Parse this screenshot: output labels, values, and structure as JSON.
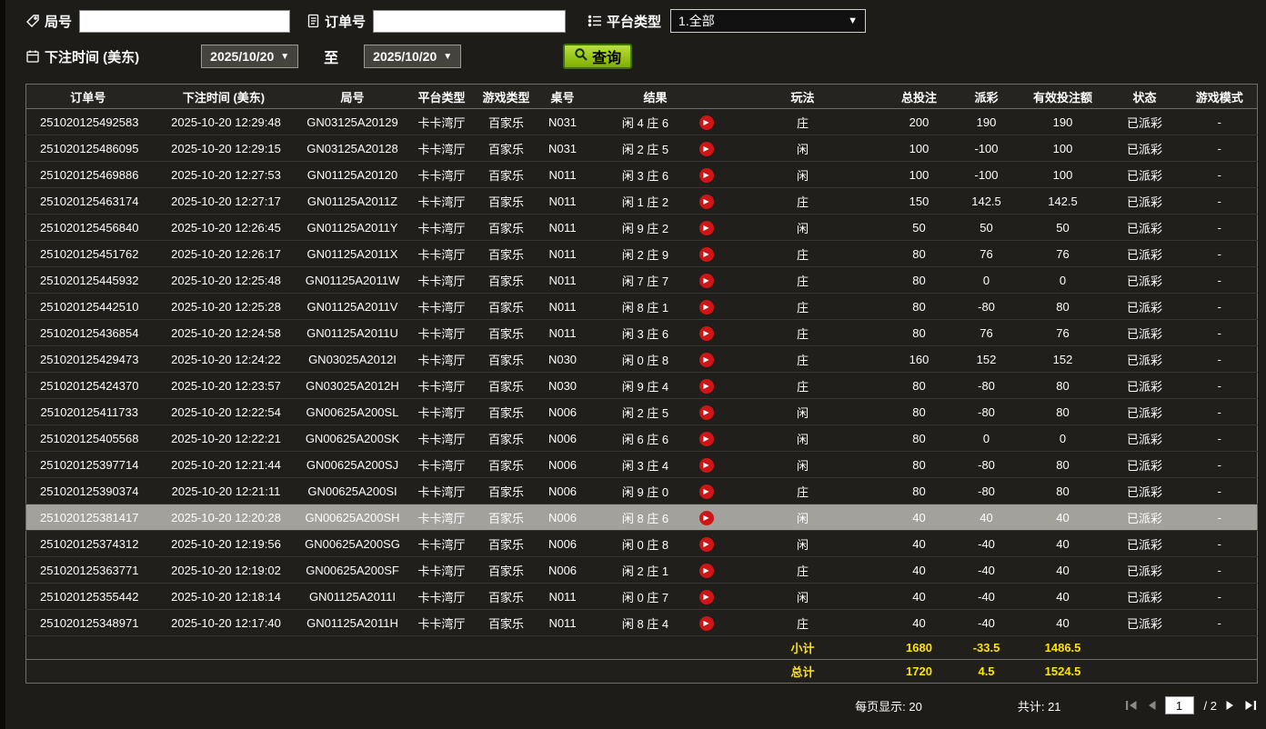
{
  "filters": {
    "round_label": "局号",
    "order_label": "订单号",
    "platform_label": "平台类型",
    "platform_value": "1.全部",
    "bet_time_label": "下注时间 (美东)",
    "date_from": "2025/10/20",
    "to_label": "至",
    "date_to": "2025/10/20",
    "query_label": "查询"
  },
  "table": {
    "headers": [
      "订单号",
      "下注时间 (美东)",
      "局号",
      "平台类型",
      "游戏类型",
      "桌号",
      "结果",
      "",
      "玩法",
      "总投注",
      "派彩",
      "有效投注额",
      "状态",
      "游戏模式"
    ],
    "rows": [
      {
        "order": "251020125492583",
        "time": "2025-10-20 12:29:48",
        "round": "GN03125A20129",
        "platform": "卡卡湾厅",
        "game": "百家乐",
        "table": "N031",
        "result": "闲 4 庄 6",
        "playtype": "庄",
        "total": "200",
        "payout": "190",
        "payout_class": "pos",
        "valid": "190",
        "status": "已派彩",
        "mode": "-",
        "selected": false
      },
      {
        "order": "251020125486095",
        "time": "2025-10-20 12:29:15",
        "round": "GN03125A20128",
        "platform": "卡卡湾厅",
        "game": "百家乐",
        "table": "N031",
        "result": "闲 2 庄 5",
        "playtype": "闲",
        "total": "100",
        "payout": "-100",
        "payout_class": "neg",
        "valid": "100",
        "status": "已派彩",
        "mode": "-",
        "selected": false
      },
      {
        "order": "251020125469886",
        "time": "2025-10-20 12:27:53",
        "round": "GN01125A20120",
        "platform": "卡卡湾厅",
        "game": "百家乐",
        "table": "N011",
        "result": "闲 3 庄 6",
        "playtype": "闲",
        "total": "100",
        "payout": "-100",
        "payout_class": "neg",
        "valid": "100",
        "status": "已派彩",
        "mode": "-",
        "selected": false
      },
      {
        "order": "251020125463174",
        "time": "2025-10-20 12:27:17",
        "round": "GN01125A2011Z",
        "platform": "卡卡湾厅",
        "game": "百家乐",
        "table": "N011",
        "result": "闲 1 庄 2",
        "playtype": "庄",
        "total": "150",
        "payout": "142.5",
        "payout_class": "pos",
        "valid": "142.5",
        "status": "已派彩",
        "mode": "-",
        "selected": false
      },
      {
        "order": "251020125456840",
        "time": "2025-10-20 12:26:45",
        "round": "GN01125A2011Y",
        "platform": "卡卡湾厅",
        "game": "百家乐",
        "table": "N011",
        "result": "闲 9 庄 2",
        "playtype": "闲",
        "total": "50",
        "payout": "50",
        "payout_class": "pos",
        "valid": "50",
        "status": "已派彩",
        "mode": "-",
        "selected": false
      },
      {
        "order": "251020125451762",
        "time": "2025-10-20 12:26:17",
        "round": "GN01125A2011X",
        "platform": "卡卡湾厅",
        "game": "百家乐",
        "table": "N011",
        "result": "闲 2 庄 9",
        "playtype": "庄",
        "total": "80",
        "payout": "76",
        "payout_class": "pos",
        "valid": "76",
        "status": "已派彩",
        "mode": "-",
        "selected": false
      },
      {
        "order": "251020125445932",
        "time": "2025-10-20 12:25:48",
        "round": "GN01125A2011W",
        "platform": "卡卡湾厅",
        "game": "百家乐",
        "table": "N011",
        "result": "闲 7 庄 7",
        "playtype": "庄",
        "total": "80",
        "payout": "0",
        "payout_class": "zero",
        "valid": "0",
        "status": "已派彩",
        "mode": "-",
        "selected": false
      },
      {
        "order": "251020125442510",
        "time": "2025-10-20 12:25:28",
        "round": "GN01125A2011V",
        "platform": "卡卡湾厅",
        "game": "百家乐",
        "table": "N011",
        "result": "闲 8 庄 1",
        "playtype": "庄",
        "total": "80",
        "payout": "-80",
        "payout_class": "neg",
        "valid": "80",
        "status": "已派彩",
        "mode": "-",
        "selected": false
      },
      {
        "order": "251020125436854",
        "time": "2025-10-20 12:24:58",
        "round": "GN01125A2011U",
        "platform": "卡卡湾厅",
        "game": "百家乐",
        "table": "N011",
        "result": "闲 3 庄 6",
        "playtype": "庄",
        "total": "80",
        "payout": "76",
        "payout_class": "pos",
        "valid": "76",
        "status": "已派彩",
        "mode": "-",
        "selected": false
      },
      {
        "order": "251020125429473",
        "time": "2025-10-20 12:24:22",
        "round": "GN03025A2012I",
        "platform": "卡卡湾厅",
        "game": "百家乐",
        "table": "N030",
        "result": "闲 0 庄 8",
        "playtype": "庄",
        "total": "160",
        "payout": "152",
        "payout_class": "pos",
        "valid": "152",
        "status": "已派彩",
        "mode": "-",
        "selected": false
      },
      {
        "order": "251020125424370",
        "time": "2025-10-20 12:23:57",
        "round": "GN03025A2012H",
        "platform": "卡卡湾厅",
        "game": "百家乐",
        "table": "N030",
        "result": "闲 9 庄 4",
        "playtype": "庄",
        "total": "80",
        "payout": "-80",
        "payout_class": "neg",
        "valid": "80",
        "status": "已派彩",
        "mode": "-",
        "selected": false
      },
      {
        "order": "251020125411733",
        "time": "2025-10-20 12:22:54",
        "round": "GN00625A200SL",
        "platform": "卡卡湾厅",
        "game": "百家乐",
        "table": "N006",
        "result": "闲 2 庄 5",
        "playtype": "闲",
        "total": "80",
        "payout": "-80",
        "payout_class": "neg",
        "valid": "80",
        "status": "已派彩",
        "mode": "-",
        "selected": false
      },
      {
        "order": "251020125405568",
        "time": "2025-10-20 12:22:21",
        "round": "GN00625A200SK",
        "platform": "卡卡湾厅",
        "game": "百家乐",
        "table": "N006",
        "result": "闲 6 庄 6",
        "playtype": "闲",
        "total": "80",
        "payout": "0",
        "payout_class": "zero",
        "valid": "0",
        "status": "已派彩",
        "mode": "-",
        "selected": false
      },
      {
        "order": "251020125397714",
        "time": "2025-10-20 12:21:44",
        "round": "GN00625A200SJ",
        "platform": "卡卡湾厅",
        "game": "百家乐",
        "table": "N006",
        "result": "闲 3 庄 4",
        "playtype": "闲",
        "total": "80",
        "payout": "-80",
        "payout_class": "neg",
        "valid": "80",
        "status": "已派彩",
        "mode": "-",
        "selected": false
      },
      {
        "order": "251020125390374",
        "time": "2025-10-20 12:21:11",
        "round": "GN00625A200SI",
        "platform": "卡卡湾厅",
        "game": "百家乐",
        "table": "N006",
        "result": "闲 9 庄 0",
        "playtype": "庄",
        "total": "80",
        "payout": "-80",
        "payout_class": "neg",
        "valid": "80",
        "status": "已派彩",
        "mode": "-",
        "selected": false
      },
      {
        "order": "251020125381417",
        "time": "2025-10-20 12:20:28",
        "round": "GN00625A200SH",
        "platform": "卡卡湾厅",
        "game": "百家乐",
        "table": "N006",
        "result": "闲 8 庄 6",
        "playtype": "闲",
        "total": "40",
        "payout": "40",
        "payout_class": "pos",
        "valid": "40",
        "status": "已派彩",
        "mode": "-",
        "selected": true
      },
      {
        "order": "251020125374312",
        "time": "2025-10-20 12:19:56",
        "round": "GN00625A200SG",
        "platform": "卡卡湾厅",
        "game": "百家乐",
        "table": "N006",
        "result": "闲 0 庄 8",
        "playtype": "闲",
        "total": "40",
        "payout": "-40",
        "payout_class": "neg",
        "valid": "40",
        "status": "已派彩",
        "mode": "-",
        "selected": false
      },
      {
        "order": "251020125363771",
        "time": "2025-10-20 12:19:02",
        "round": "GN00625A200SF",
        "platform": "卡卡湾厅",
        "game": "百家乐",
        "table": "N006",
        "result": "闲 2 庄 1",
        "playtype": "庄",
        "total": "40",
        "payout": "-40",
        "payout_class": "neg",
        "valid": "40",
        "status": "已派彩",
        "mode": "-",
        "selected": false
      },
      {
        "order": "251020125355442",
        "time": "2025-10-20 12:18:14",
        "round": "GN01125A2011I",
        "platform": "卡卡湾厅",
        "game": "百家乐",
        "table": "N011",
        "result": "闲 0 庄 7",
        "playtype": "闲",
        "total": "40",
        "payout": "-40",
        "payout_class": "neg",
        "valid": "40",
        "status": "已派彩",
        "mode": "-",
        "selected": false
      },
      {
        "order": "251020125348971",
        "time": "2025-10-20 12:17:40",
        "round": "GN01125A2011H",
        "platform": "卡卡湾厅",
        "game": "百家乐",
        "table": "N011",
        "result": "闲 8 庄 4",
        "playtype": "庄",
        "total": "40",
        "payout": "-40",
        "payout_class": "neg",
        "valid": "40",
        "status": "已派彩",
        "mode": "-",
        "selected": false
      }
    ],
    "subtotal": {
      "label": "小计",
      "total_bet": "1680",
      "payout": "-33.5",
      "valid_bet": "1486.5"
    },
    "total": {
      "label": "总计",
      "total_bet": "1720",
      "payout": "4.5",
      "valid_bet": "1524.5"
    }
  },
  "pagination": {
    "per_page": "每页显示: 20",
    "total_count": "共计: 21",
    "page": "1",
    "page_divider": "/ 2"
  },
  "colors": {
    "query_button_green": "#8db600",
    "payout_win_red": "#d03434",
    "payout_loss_green": "#9ccc3c",
    "status_paid_green": "#1ecb4f",
    "totals_yellow": "#ffe400"
  }
}
